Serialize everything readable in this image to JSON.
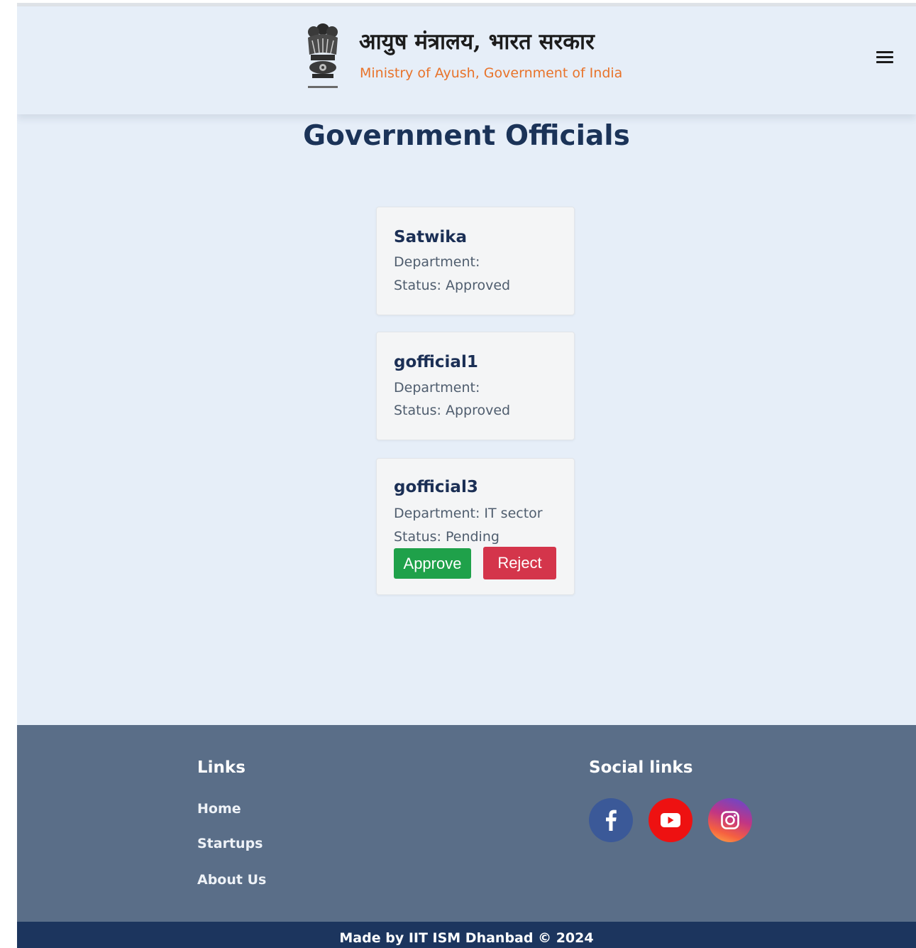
{
  "header": {
    "hindi_title": "आयुष मंत्रालय, भारत सरकार",
    "english_title": "Ministry of Ayush, Government of India",
    "menu_icon": "hamburger-menu-icon",
    "emblem_icon": "national-emblem-icon"
  },
  "page_title": "Government Officials",
  "officials": [
    {
      "name": "Satwika",
      "department": "Department:",
      "status": "Status: Approved"
    },
    {
      "name": "gofficial1",
      "department": "Department:",
      "status": "Status: Approved"
    },
    {
      "name": "gofficial3",
      "department": "Department: IT sector",
      "status": "Status: Pending",
      "approve_label": "Approve",
      "reject_label": "Reject"
    }
  ],
  "footer": {
    "links_heading": "Links",
    "links": [
      "Home",
      "Startups",
      "About Us"
    ],
    "social_heading": "Social links",
    "social": [
      "facebook-icon",
      "youtube-icon",
      "instagram-icon"
    ],
    "credits": "Made by IIT ISM Dhanbad © 2024"
  },
  "colors": {
    "page_bg": "#e6eef8",
    "title": "#1b3358",
    "brand_orange": "#e8732a",
    "approve": "#1fa14a",
    "reject": "#d4354b",
    "footer_bg": "#5a6e88",
    "bottom_bar": "#1c355e"
  }
}
